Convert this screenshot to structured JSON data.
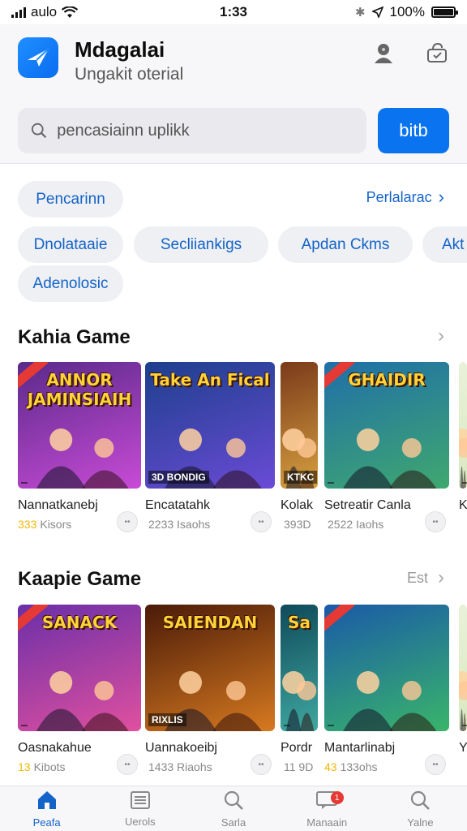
{
  "status_bar": {
    "carrier": "aulo",
    "time": "1:33",
    "battery": "100%",
    "battery_level": 1.0
  },
  "header": {
    "app_name": "Mdagalai",
    "app_subtitle": "Ungakit oterial",
    "search": {
      "placeholder": "pencasiainn uplikk",
      "value": ""
    },
    "search_button": "bitb"
  },
  "chips": {
    "see_all": "Perlalarac",
    "items": [
      "Pencarinn",
      "Dnolataaie",
      "Secliiankigs",
      "Apdan Ckms",
      "Akt",
      "Adenolosic"
    ]
  },
  "sections": [
    {
      "title": "Kahia Game",
      "action": "",
      "cards": [
        {
          "art_title": "ANNOR JAMINSIAIH",
          "art_tag": "",
          "title": "Nannatkanebj",
          "rating_stars": "333",
          "meta": "Kisors",
          "colors": [
            "#5a2a8a",
            "#c84bd6"
          ]
        },
        {
          "art_title": "Take An Fical",
          "art_tag": "3D BONDIG",
          "title": "Encatatahk",
          "rating_stars": "",
          "meta": "2233 Isaohs",
          "colors": [
            "#1d3f8c",
            "#6a4bd6"
          ]
        },
        {
          "art_title": "",
          "art_tag": "KTKC",
          "title": "Kolak",
          "rating_stars": "",
          "meta": "393D",
          "colors": [
            "#7a3a1a",
            "#d7a040"
          ]
        },
        {
          "art_title": "GHAIDIR",
          "art_tag": "",
          "title": "Setreatir Canla",
          "rating_stars": "",
          "meta": "2522 Iaohs",
          "colors": [
            "#1f6fa8",
            "#3fa86f"
          ]
        },
        {
          "art_title": "",
          "art_tag": "",
          "title": "K",
          "rating_stars": "",
          "meta": "",
          "colors": [
            "#e9f2d9",
            "#d8e9c0"
          ]
        }
      ]
    },
    {
      "title": "Kaapie Game",
      "action": "Est",
      "cards": [
        {
          "art_title": "SANACK",
          "art_tag": "",
          "title": "Oasnakahue",
          "rating_stars": "13",
          "meta": "Kibots",
          "colors": [
            "#6a2fa8",
            "#e0509f"
          ]
        },
        {
          "art_title": "SAIENDAN",
          "art_tag": "RIXLIS",
          "title": "Uannakoeibj",
          "rating_stars": "",
          "meta": "1433 Riaohs",
          "colors": [
            "#4a1a08",
            "#d77a20"
          ]
        },
        {
          "art_title": "Sa",
          "art_tag": "",
          "title": "Pordr",
          "rating_stars": "",
          "meta": "11 9D",
          "colors": [
            "#0f4a5a",
            "#3fa8a0"
          ]
        },
        {
          "art_title": "",
          "art_tag": "",
          "title": "Mantarlinabj",
          "rating_stars": "43",
          "meta": "133ohs",
          "colors": [
            "#1a5aa8",
            "#39b56a"
          ]
        },
        {
          "art_title": "",
          "art_tag": "",
          "title": "Y",
          "rating_stars": "",
          "meta": "",
          "colors": [
            "#e9f2d9",
            "#d8e9c0"
          ]
        }
      ]
    }
  ],
  "tab_bar": [
    {
      "label": "Peafa",
      "icon": "home-icon",
      "active": true
    },
    {
      "label": "Uerols",
      "icon": "list-icon",
      "active": false
    },
    {
      "label": "Sarla",
      "icon": "search-icon",
      "active": false
    },
    {
      "label": "Manaain",
      "icon": "message-icon",
      "active": false,
      "badge": "1"
    },
    {
      "label": "Yalne",
      "icon": "search-icon",
      "active": false
    }
  ],
  "colors": {
    "accent": "#0a74f0",
    "link": "#1463c9",
    "chip_bg": "#eef0f3"
  }
}
